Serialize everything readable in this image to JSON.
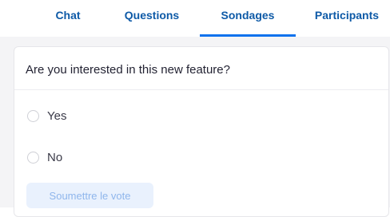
{
  "tabs": [
    {
      "label": "Chat",
      "active": false
    },
    {
      "label": "Questions",
      "active": false
    },
    {
      "label": "Sondages",
      "active": true
    },
    {
      "label": "Participants",
      "active": false
    }
  ],
  "poll": {
    "question": "Are you interested in this new feature?",
    "options": [
      {
        "label": "Yes",
        "selected": false
      },
      {
        "label": "No",
        "selected": false
      }
    ],
    "submit_label": "Soumettre le vote",
    "submit_enabled": false
  },
  "colors": {
    "tab_text": "#0e5aa7",
    "active_tab_underline": "#0e72ed",
    "panel_background": "#f4f4f6",
    "submit_background_disabled": "#e9f1fd",
    "submit_text_disabled": "#8fb6ec"
  }
}
